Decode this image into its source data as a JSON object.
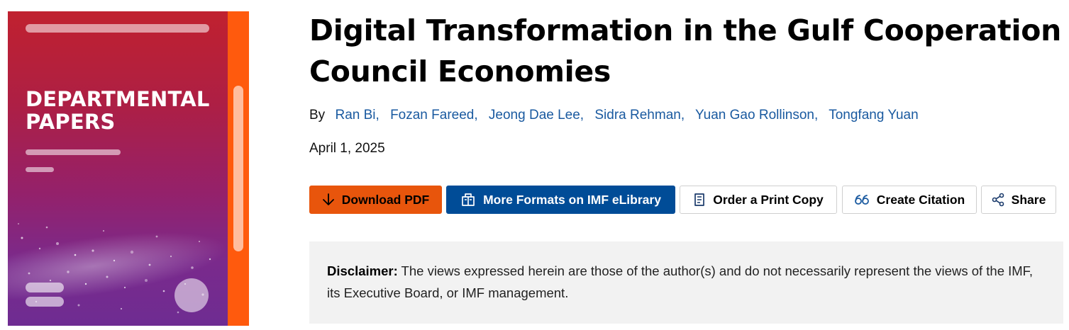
{
  "cover": {
    "title_line1": "DEPARTMENTAL",
    "title_line2": "PAPERS",
    "colors": {
      "top": "#c0212f",
      "bottom": "#6e2c92",
      "stripe": "#ff5a0d"
    }
  },
  "title": "Digital Transformation in the Gulf Cooperation Council Economies",
  "byline": {
    "prefix": "By",
    "authors": [
      "Ran Bi,",
      "Fozan Fareed,",
      "Jeong Dae Lee,",
      "Sidra Rehman,",
      "Yuan Gao Rollinson,",
      "Tongfang Yuan"
    ]
  },
  "date": "April 1, 2025",
  "actions": {
    "download": {
      "label": "Download PDF",
      "icon": "arrow-down-icon"
    },
    "formats": {
      "label": "More Formats on IMF eLibrary",
      "icon": "book-open-icon"
    },
    "print": {
      "label": "Order a Print Copy",
      "icon": "book-icon"
    },
    "cite": {
      "label": "Create Citation",
      "icon": "quote-icon"
    },
    "share": {
      "label": "Share",
      "icon": "share-icon"
    }
  },
  "disclaimer": {
    "label": "Disclaimer:",
    "text": " The views expressed herein are those of the author(s) and do not necessarily represent the views of the IMF, its Executive Board, or IMF management."
  },
  "colors": {
    "accent_orange": "#e8550c",
    "accent_blue": "#004c97",
    "link": "#1a5aa0"
  }
}
